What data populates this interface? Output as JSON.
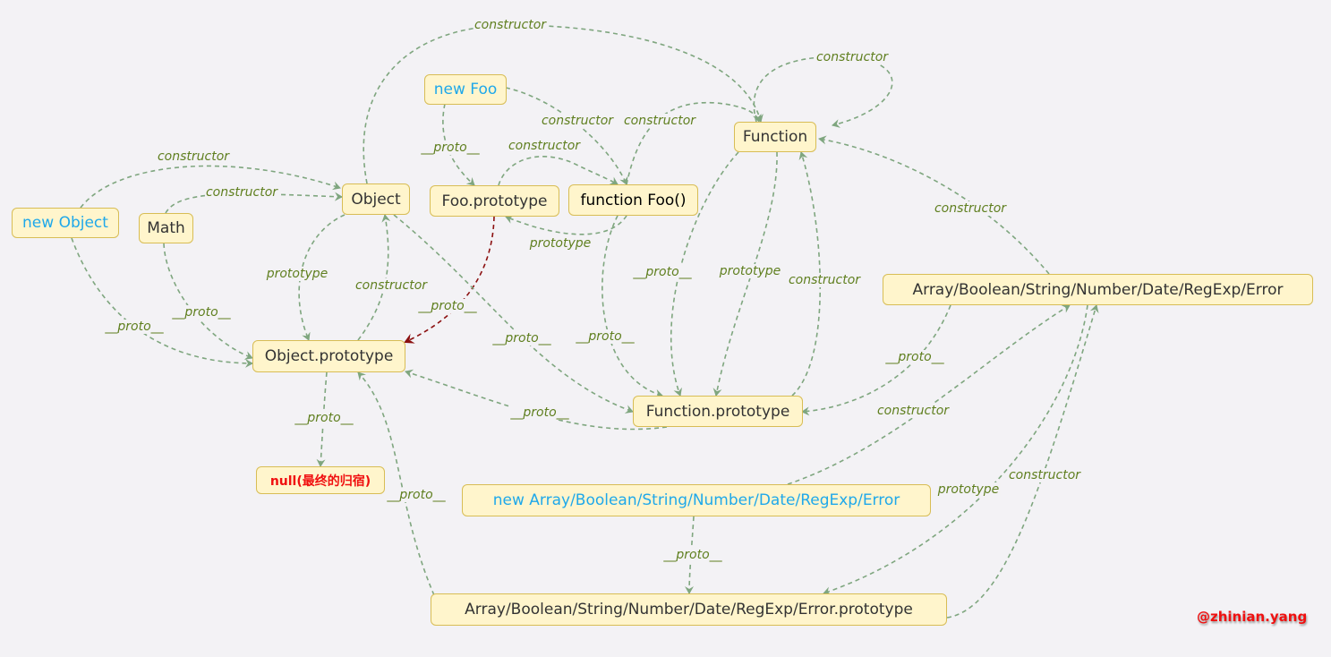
{
  "colors": {
    "edge": "#7fa67f",
    "highlight_edge": "#8b1010",
    "node_fill": "#fff5cc",
    "node_border": "#d8bd55",
    "label": "#5f7f1f",
    "instance_text": "#1fa8ea",
    "null_text": "#f01010"
  },
  "nodes": {
    "new_foo": "new Foo",
    "function": "Function",
    "object": "Object",
    "foo_prototype": "Foo.prototype",
    "function_foo": "function Foo()",
    "new_object": "new Object",
    "math": "Math",
    "builtins": "Array/Boolean/String/Number/Date/RegExp/Error",
    "object_prototype": "Object.prototype",
    "function_prototype": "Function.prototype",
    "null": "null(最终的归宿)",
    "new_builtins": "new Array/Boolean/String/Number/Date/RegExp/Error",
    "builtins_prototype": "Array/Boolean/String/Number/Date/RegExp/Error.prototype"
  },
  "edges": [
    {
      "label": "constructor",
      "from": "object",
      "to": "function"
    },
    {
      "label": "constructor",
      "from": "function",
      "to": "function"
    },
    {
      "label": "__proto__",
      "from": "new_foo",
      "to": "foo_prototype"
    },
    {
      "label": "constructor",
      "from": "new_foo",
      "to": "function_foo"
    },
    {
      "label": "constructor",
      "from": "function_foo",
      "to": "function"
    },
    {
      "label": "constructor",
      "from": "foo_prototype",
      "to": "function_foo"
    },
    {
      "label": "prototype",
      "from": "function_foo",
      "to": "foo_prototype"
    },
    {
      "label": "constructor",
      "from": "new_object",
      "to": "object"
    },
    {
      "label": "constructor",
      "from": "math",
      "to": "object"
    },
    {
      "label": "__proto__",
      "from": "new_object",
      "to": "object_prototype"
    },
    {
      "label": "__proto__",
      "from": "math",
      "to": "object_prototype"
    },
    {
      "label": "prototype",
      "from": "object",
      "to": "object_prototype"
    },
    {
      "label": "constructor",
      "from": "object_prototype",
      "to": "object"
    },
    {
      "label": "__proto__",
      "from": "foo_prototype",
      "to": "object_prototype",
      "highlight": true
    },
    {
      "label": "__proto__",
      "from": "object",
      "to": "function_prototype"
    },
    {
      "label": "__proto__",
      "from": "function_prototype",
      "to": "object_prototype"
    },
    {
      "label": "__proto__",
      "from": "object_prototype",
      "to": "null"
    },
    {
      "label": "__proto__",
      "from": "function_foo",
      "to": "function_prototype"
    },
    {
      "label": "__proto__",
      "from": "function",
      "to": "function_prototype"
    },
    {
      "label": "prototype",
      "from": "function",
      "to": "function_prototype"
    },
    {
      "label": "constructor",
      "from": "function_prototype",
      "to": "function"
    },
    {
      "label": "constructor",
      "from": "builtins",
      "to": "function"
    },
    {
      "label": "__proto__",
      "from": "builtins",
      "to": "function_prototype"
    },
    {
      "label": "constructor",
      "from": "new_builtins",
      "to": "builtins"
    },
    {
      "label": "__proto__",
      "from": "new_builtins",
      "to": "builtins_prototype"
    },
    {
      "label": "__proto__",
      "from": "builtins_prototype",
      "to": "object_prototype"
    },
    {
      "label": "prototype",
      "from": "builtins",
      "to": "builtins_prototype"
    },
    {
      "label": "constructor",
      "from": "builtins_prototype",
      "to": "builtins"
    }
  ],
  "signature": "@zhinian.yang"
}
